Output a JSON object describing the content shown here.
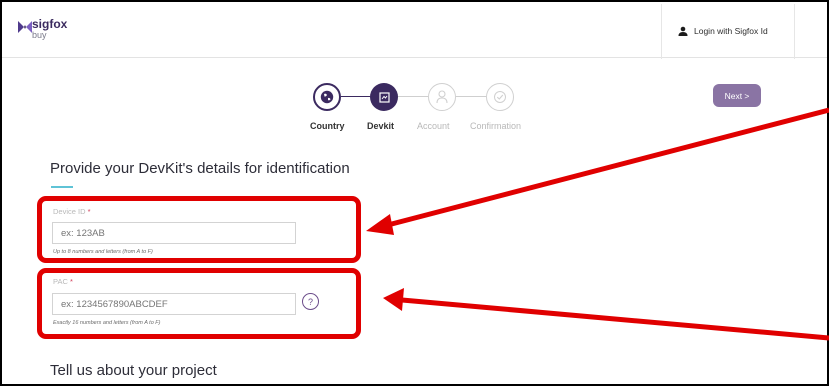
{
  "header": {
    "brand": "sigfox",
    "brand_sub": "buy",
    "login_label": "Login with Sigfox Id"
  },
  "steps": [
    {
      "label": "Country",
      "status": "done",
      "icon": "globe-icon"
    },
    {
      "label": "Devkit",
      "status": "current",
      "icon": "devkit-icon"
    },
    {
      "label": "Account",
      "status": "pending",
      "icon": "user-icon"
    },
    {
      "label": "Confirmation",
      "status": "pending",
      "icon": "check-icon"
    }
  ],
  "next_label": "Next >",
  "section_title": "Provide your DevKit's details for identification",
  "device_id": {
    "label": "Device ID",
    "required_mark": "*",
    "placeholder": "ex: 123AB",
    "hint": "Up to 8 numbers and letters (from A to F)"
  },
  "pac": {
    "label": "PAC",
    "required_mark": "*",
    "placeholder": "ex: 1234567890ABCDEF",
    "hint": "Exactly 16 numbers and letters (from A to F)",
    "help": "?"
  },
  "project_title": "Tell us about your project",
  "colors": {
    "accent": "#3b2a60",
    "button": "#8a74a4",
    "underline": "#5fc3d6",
    "highlight": "#e00000",
    "required": "#d13f5a"
  }
}
